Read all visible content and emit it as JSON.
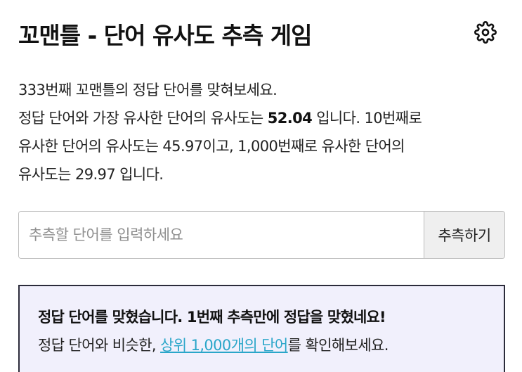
{
  "header": {
    "title": "꼬맨틀 - 단어 유사도 추측 게임",
    "settings_icon": "gear-icon"
  },
  "description": {
    "line1": "333번째 꼬맨틀의 정답 단어를 맞혀보세요.",
    "line2_prefix": "정답 단어와 가장 유사한 단어의 유사도는 ",
    "top_similarity": "52.04",
    "line2_suffix": " 입니다. 10번째로",
    "line3": "유사한 단어의 유사도는 45.97이고, 1,000번째로 유사한 단어의",
    "line4": "유사도는 29.97 입니다."
  },
  "guess": {
    "placeholder": "추측할 단어를 입력하세요",
    "value": "",
    "button_label": "추측하기"
  },
  "result": {
    "headline": "정답 단어를 맞혔습니다. 1번째 추측만에 정답을 맞혔네요!",
    "line2_prefix": "정답 단어와 비슷한, ",
    "link_text": "상위 1,000개의 단어",
    "line2_suffix": "를 확인해보세요."
  },
  "colors": {
    "result_background": "#f1f0fc",
    "result_border": "#2b2b3a",
    "link": "#2aa6c9",
    "button_background": "#efefef"
  }
}
